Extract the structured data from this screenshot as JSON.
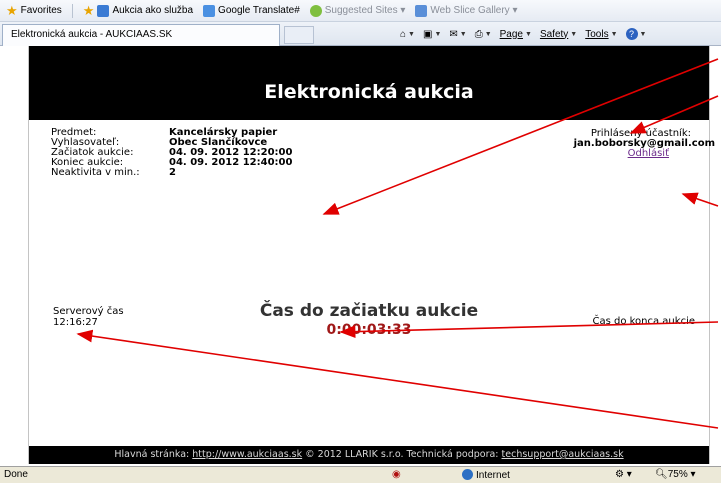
{
  "browser": {
    "favorites_label": "Favorites",
    "links": [
      "Aukcia ako služba",
      "Google Translate#",
      "Suggested Sites ▾",
      "Web Slice Gallery ▾"
    ],
    "tab_title": "Elektronická aukcia - AUKCIAAS.SK",
    "toolbar": {
      "page": "Page",
      "safety": "Safety",
      "tools": "Tools"
    }
  },
  "page": {
    "title": "Elektronická aukcia",
    "info": [
      {
        "label": "Predmet:",
        "value": "Kancelársky papier"
      },
      {
        "label": "Vyhlasovateľ:",
        "value": "Obec Slančíkovce"
      },
      {
        "label": "Začiatok aukcie:",
        "value": "04. 09. 2012 12:20:00"
      },
      {
        "label": "Koniec aukcie:",
        "value": "04. 09. 2012 12:40:00"
      },
      {
        "label": "Neaktivita v min.:",
        "value": "2"
      }
    ],
    "participant": {
      "label": "Prihlásený účastník:",
      "email": "jan.boborsky@gmail.com",
      "logout": "Odhlásiť"
    },
    "server_time": {
      "label": "Serverový čas",
      "value": "12:16:27"
    },
    "countdown": {
      "title": "Čas do začiatku aukcie",
      "time": "0:00:03:33"
    },
    "end_label": "Čas do konca aukcie",
    "footer": {
      "prefix": "Hlavná stránka: ",
      "home_link": "http://www.aukciaas.sk",
      "middle": " © 2012 LLARIK s.r.o. Technická podpora: ",
      "support_link": "techsupport@aukciaas.sk"
    }
  },
  "statusbar": {
    "left": "Done",
    "zone": "Internet",
    "zoom": "75%"
  },
  "colors": {
    "header_bg": "#000000",
    "countdown_time": "#a01818",
    "arrow": "#e00000",
    "logout_link": "#6b2a8a"
  }
}
